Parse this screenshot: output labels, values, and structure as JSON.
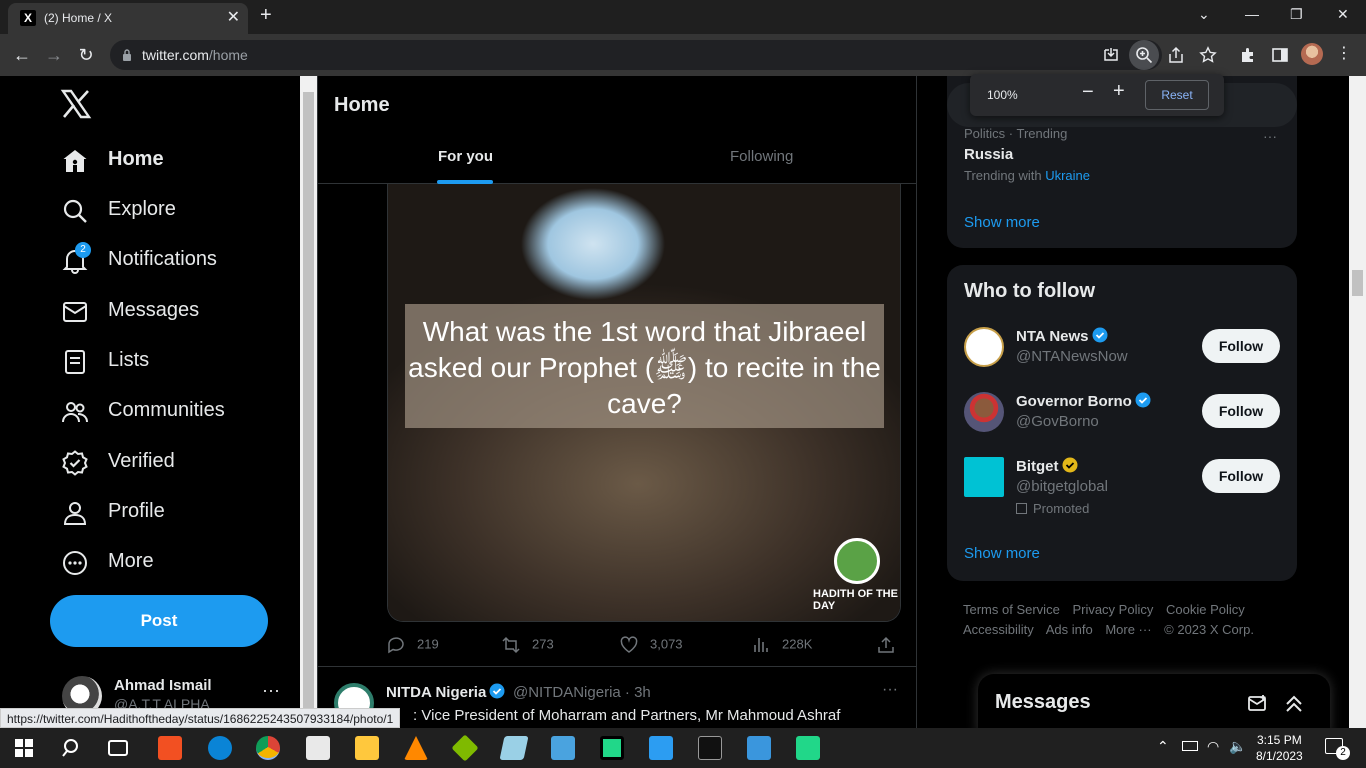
{
  "browser": {
    "tab_title": "(2) Home / X",
    "favicon": "X",
    "url_host": "twitter.com",
    "url_path": "/home"
  },
  "zoom": {
    "percent": "100%",
    "minus": "−",
    "plus": "+",
    "reset": "Reset"
  },
  "sidebar": {
    "logo": "X",
    "items": [
      {
        "label": "Home",
        "icon": "home-icon"
      },
      {
        "label": "Explore",
        "icon": "search-icon"
      },
      {
        "label": "Notifications",
        "icon": "bell-icon",
        "badge": "2"
      },
      {
        "label": "Messages",
        "icon": "mail-icon"
      },
      {
        "label": "Lists",
        "icon": "list-icon"
      },
      {
        "label": "Communities",
        "icon": "people-icon"
      },
      {
        "label": "Verified",
        "icon": "verified-icon"
      },
      {
        "label": "Profile",
        "icon": "person-icon"
      },
      {
        "label": "More",
        "icon": "more-circle-icon"
      }
    ],
    "post_label": "Post",
    "account": {
      "name": "Ahmad Ismail",
      "handle": "@A.T.T ALPHA"
    }
  },
  "main": {
    "title": "Home",
    "tabs": [
      {
        "label": "For you"
      },
      {
        "label": "Following"
      }
    ],
    "tweet1": {
      "image_caption": "What was the 1st word that Jibraeel asked our Prophet (ﷺ) to recite in the cave?",
      "brand": "HADITH OF THE DAY",
      "replies": "219",
      "retweets": "273",
      "likes": "3,073",
      "views": "228K"
    },
    "tweet2": {
      "name": "NITDA Nigeria",
      "handle_time": "@NITDANigeria · 3h",
      "text": ": Vice President of Moharram and Partners, Mr Mahmoud Ashraf"
    },
    "status_url": "https://twitter.com/Hadithoftheday/status/1686225243507933184/photo/1"
  },
  "right": {
    "trend": {
      "category": "Politics · Trending",
      "name": "Russia",
      "trending_with_prefix": "Trending with",
      "trending_with": "Ukraine",
      "show_more": "Show more"
    },
    "who_to_follow": {
      "title": "Who to follow",
      "accounts": [
        {
          "name": "NTA News",
          "handle": "@NTANewsNow",
          "button": "Follow",
          "check": "blue"
        },
        {
          "name": "Governor Borno",
          "handle": "@GovBorno",
          "button": "Follow",
          "check": "blue"
        },
        {
          "name": "Bitget",
          "handle": "@bitgetglobal",
          "button": "Follow",
          "check": "gold",
          "promoted": "Promoted"
        }
      ],
      "show_more": "Show more"
    },
    "footer": [
      "Terms of Service",
      "Privacy Policy",
      "Cookie Policy",
      "Accessibility",
      "Ads info",
      "More ···",
      "© 2023 X Corp."
    ],
    "messages_title": "Messages"
  },
  "taskbar": {
    "time": "3:15 PM",
    "date": "8/1/2023",
    "notif_count": "2"
  },
  "colors": {
    "accent": "#1d9bf0",
    "bg": "#000000",
    "card": "#16181c"
  }
}
